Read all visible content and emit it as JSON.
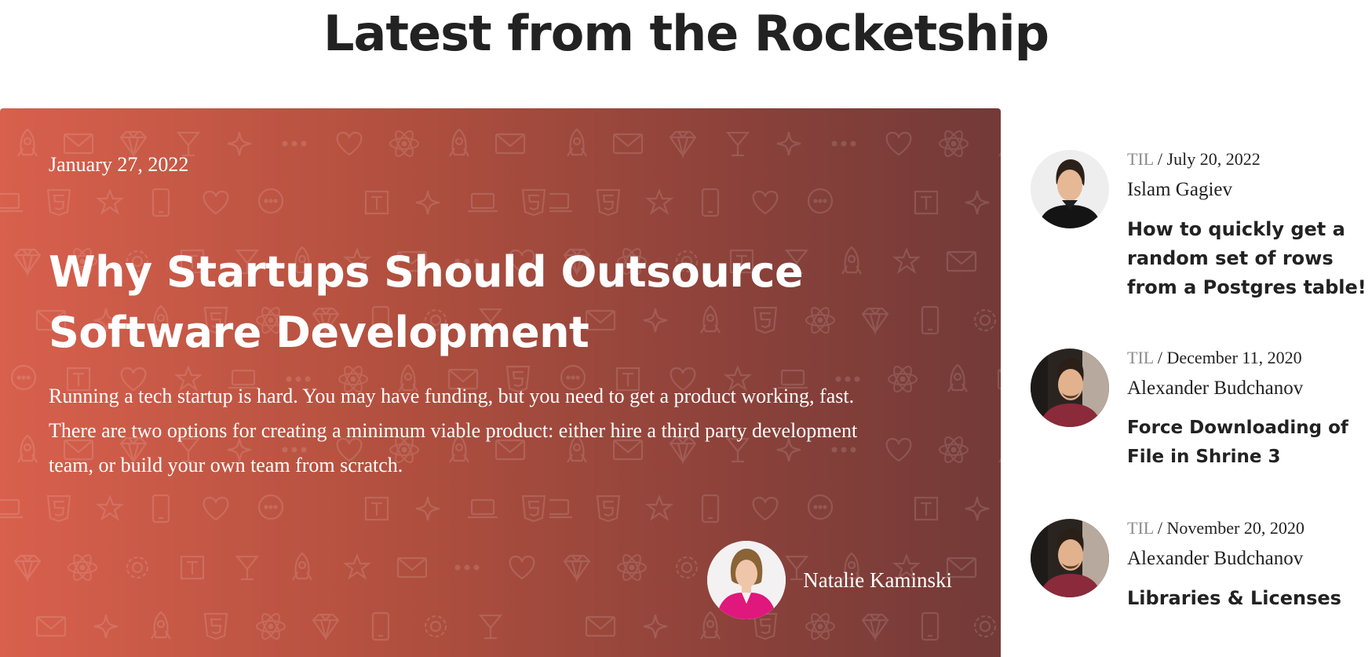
{
  "section": {
    "title": "Latest from the Rocketship"
  },
  "featured": {
    "date": "January 27, 2022",
    "title": "Why Startups Should Outsource Software Development",
    "excerpt": "Running a tech startup is hard. You may have funding, but you need to get a product working, fast. There are two options for creating a minimum viable product: either hire a third party development team, or build your own team from scratch.",
    "author": "Natalie Kaminski",
    "background_colors": [
      "#d8604d",
      "#733a38"
    ]
  },
  "sidebar": {
    "posts": [
      {
        "category": "TIL",
        "separator": " / ",
        "date": "July 20, 2022",
        "author": "Islam Gagiev",
        "title": "How to quickly get a random set of rows from a Postgres table!"
      },
      {
        "category": "TIL",
        "separator": " / ",
        "date": "December 11, 2020",
        "author": "Alexander Budchanov",
        "title": "Force Downloading of File in Shrine 3"
      },
      {
        "category": "TIL",
        "separator": " / ",
        "date": "November 20, 2020",
        "author": "Alexander Budchanov",
        "title": "Libraries & Licenses"
      }
    ]
  },
  "colors": {
    "text": "#222222",
    "category": "#8c8c8c",
    "white": "#ffffff"
  }
}
